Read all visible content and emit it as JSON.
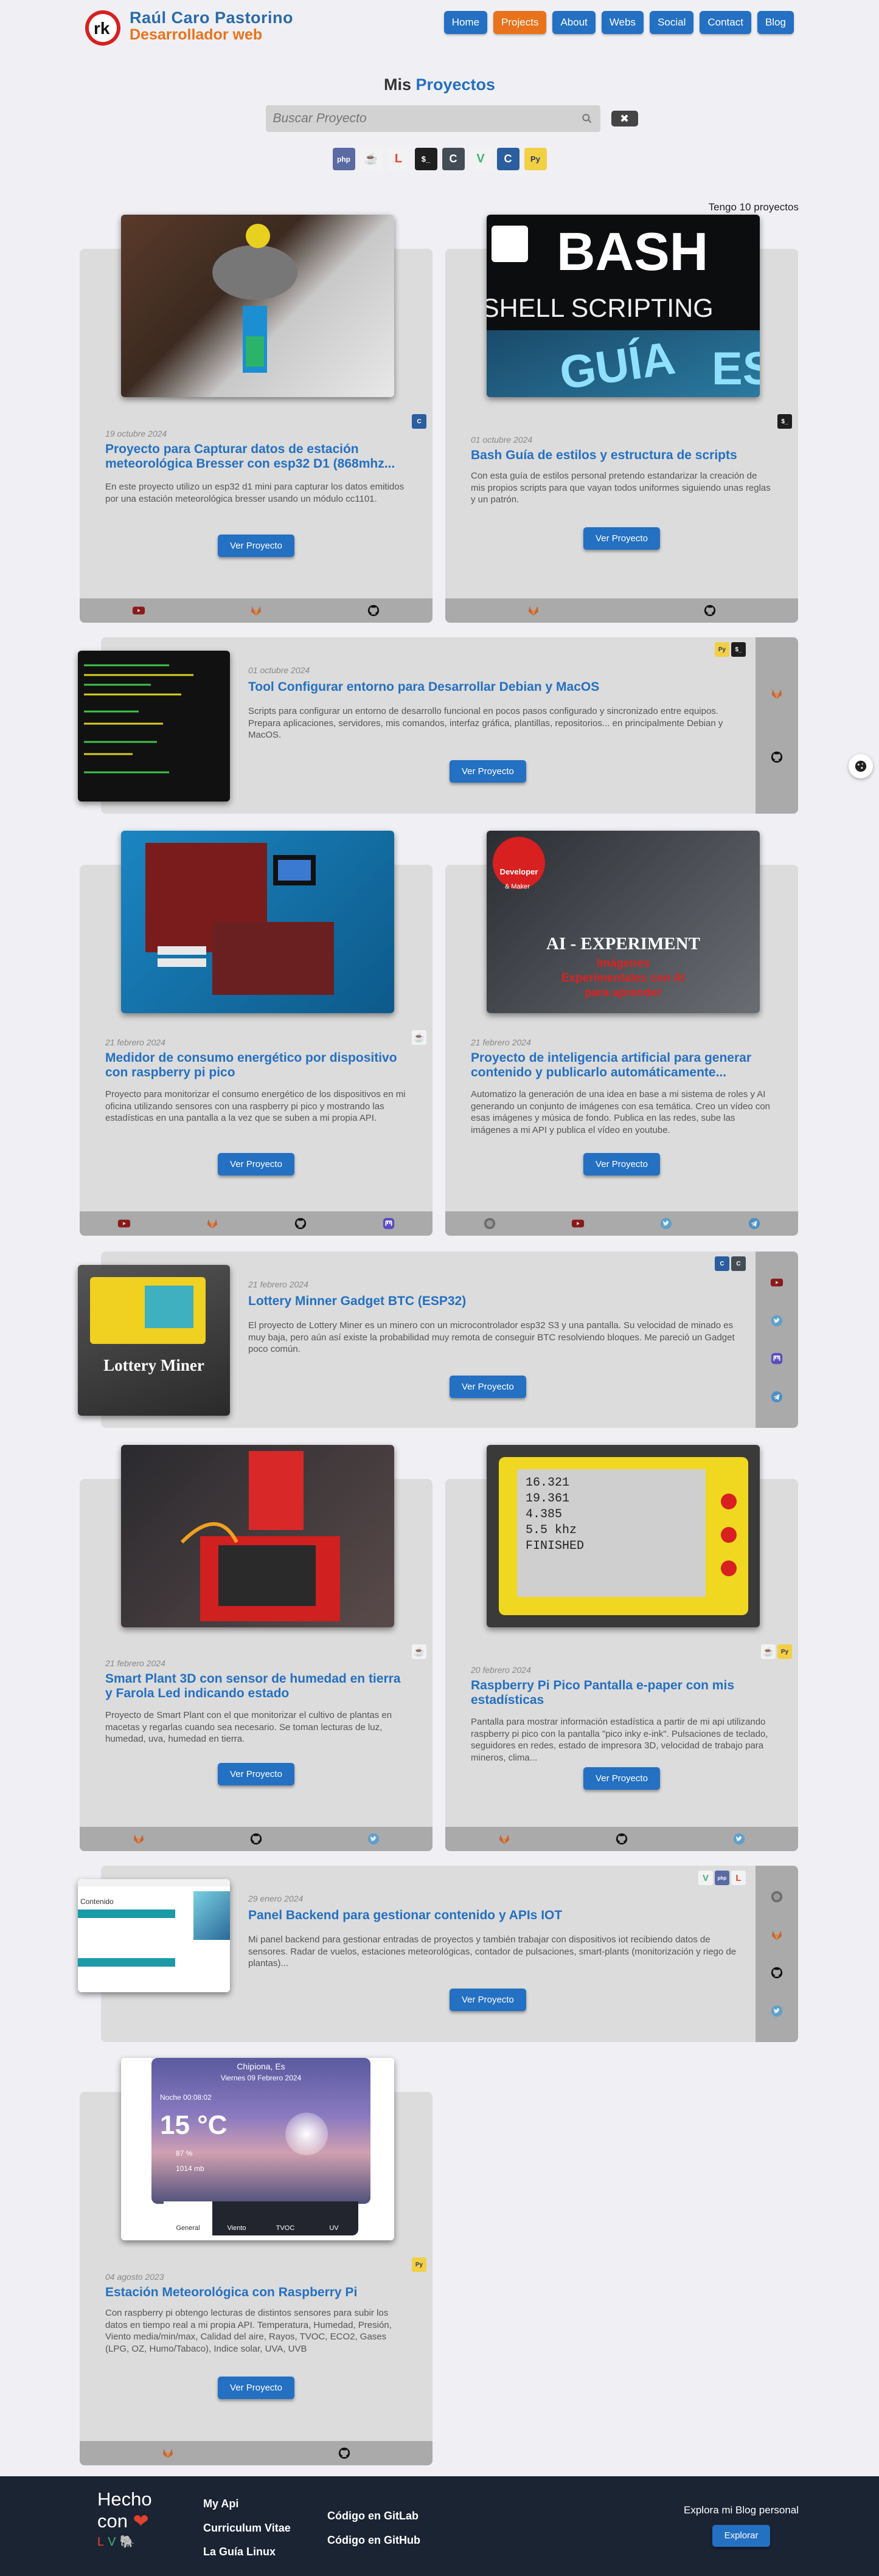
{
  "header": {
    "name": "Raúl Caro Pastorino",
    "role": "Desarrollador web",
    "nav": [
      "Home",
      "Projects",
      "About",
      "Webs",
      "Social",
      "Contact",
      "Blog"
    ],
    "active": "Projects"
  },
  "section": {
    "title_prefix": "Mis",
    "title_accent": "Proyectos"
  },
  "search": {
    "placeholder": "Buscar Proyecto",
    "clear_label": "✖"
  },
  "filters": [
    {
      "icon": "php-icon",
      "label": "php"
    },
    {
      "icon": "java-icon",
      "label": "☕"
    },
    {
      "icon": "laravel-icon",
      "label": "L"
    },
    {
      "icon": "bash-icon",
      "label": "$_"
    },
    {
      "icon": "c-icon",
      "label": "C"
    },
    {
      "icon": "vue-icon",
      "label": "V"
    },
    {
      "icon": "c-icon",
      "label": "C"
    },
    {
      "icon": "python-icon",
      "label": "Py"
    }
  ],
  "count_text": "Tengo 10 proyectos",
  "colors": {
    "primary": "#2470c2",
    "accent": "#e8731c",
    "card": "#dcdcdc",
    "bar": "#aaaaaa",
    "footer": "#1b2433"
  },
  "cta": "Ver Proyecto",
  "projects": [
    {
      "date": "19 octubre 2024",
      "title": "Proyecto para Capturar datos de estación meteorológica Bresser con esp32 D1 (868mhz...",
      "desc": "En este proyecto utilizo un esp32 d1 mini para capturar los datos emitidos por una estación meteorológica bresser usando un módulo cc1101.",
      "links": [
        "youtube-icon",
        "gitlab-icon",
        "github-icon"
      ]
    },
    {
      "date": "01 octubre 2024",
      "title": "Bash Guía de estilos y estructura de scripts",
      "desc": "Con esta guía de estilos personal pretendo estandarizar la creación de mis propios scripts para que vayan todos uniformes siguiendo unas reglas y un patrón.",
      "links": [
        "gitlab-icon",
        "github-icon"
      ],
      "img_text": [
        "BASH",
        "SHELL SCRIPTING",
        "GUÍA",
        "EST"
      ]
    },
    {
      "date": "01 octubre 2024",
      "title": "Tool Configurar entorno para Desarrollar Debian y MacOS",
      "desc": "Scripts para configurar un entorno de desarrollo funcional en pocos pasos configurado y sincronizado entre equipos. Prepara aplicaciones, servidores, mis comandos, interfaz gráfica, plantillas, repositorios... en principalmente Debian y MacOS.",
      "links": [
        "gitlab-icon",
        "github-icon"
      ]
    },
    {
      "date": "21 febrero 2024",
      "title": "Medidor de consumo energético por dispositivo con raspberry pi pico",
      "desc": "Proyecto para monitorizar el consumo energético de los dispositivos en mi oficina utilizando sensores con una raspberry pi pico y mostrando las estadísticas en una pantalla a la vez que se suben a mi propia API.",
      "links": [
        "youtube-icon",
        "gitlab-icon",
        "github-icon",
        "mastodon-icon"
      ]
    },
    {
      "date": "21 febrero 2024",
      "title": "Proyecto de inteligencia artificial para generar contenido y publicarlo automáticamente...",
      "desc": "Automatizo la generación de una idea en base a mi sistema de roles y AI generando un conjunto de imágenes con esa temática. Creo un vídeo con esas imágenes y música de fondo. Publica en las redes, sube las imágenes a mi API y publica el vídeo en youtube.",
      "links": [
        "web-icon",
        "youtube-icon",
        "twitter-icon",
        "telegram-icon"
      ],
      "img_text": [
        "Developer",
        "& Maker",
        "AI - EXPERIMENT",
        "Imágenes",
        "Experimentales con AI",
        "para aprender"
      ]
    },
    {
      "date": "21 febrero 2024",
      "title": "Lottery Minner Gadget BTC (ESP32)",
      "desc": "El proyecto de Lottery Miner es un minero con un microcontrolador esp32 S3 y una pantalla. Su velocidad de minado es muy baja, pero aún así existe la probabilidad muy remota de conseguir BTC resolviendo bloques. Me pareció un Gadget poco común.",
      "links": [
        "youtube-icon",
        "twitter-icon",
        "mastodon-icon",
        "telegram-icon"
      ],
      "img_text": [
        "Lottery Miner"
      ]
    },
    {
      "date": "21 febrero 2024",
      "title": "Smart Plant 3D con sensor de humedad en tierra y Farola Led indicando estado",
      "desc": "Proyecto de Smart Plant con el que monitorizar el cultivo de plantas en macetas y regarlas cuando sea necesario. Se toman lecturas de luz, humedad, uva, humedad en tierra.",
      "links": [
        "gitlab-icon",
        "github-icon",
        "twitter-icon"
      ]
    },
    {
      "date": "20 febrero 2024",
      "title": "Raspberry Pi Pico Pantalla e-paper con mis estadísticas",
      "desc": "Pantalla para mostrar información estadística a partir de mi api utilizando raspberry pi pico con la pantalla \"pico inky e-ink\". Pulsaciones de teclado, seguidores en redes, estado de impresora 3D, velocidad de trabajo para mineros, clima...",
      "links": [
        "gitlab-icon",
        "github-icon",
        "twitter-icon"
      ],
      "img_text": [
        "16.321",
        "19.361",
        "4.385",
        "5.5 khz",
        "FINISHED"
      ]
    },
    {
      "date": "29 enero 2024",
      "title": "Panel Backend para gestionar contenido y APIs IOT",
      "desc": "Mi panel backend para gestionar entradas de proyectos y también trabajar con dispositivos iot recibiendo datos de sensores. Radar de vuelos, estaciones meteorológicas, contador de pulsaciones, smart-plants (monitorización y riego de plantas)...",
      "links": [
        "web-icon",
        "gitlab-icon",
        "github-icon",
        "twitter-icon"
      ],
      "img_text": [
        "Contenido"
      ]
    },
    {
      "date": "04 agosto 2023",
      "title": "Estación Meteorológica con Raspberry Pi",
      "desc": "Con raspberry pi obtengo lecturas de distintos sensores para subir los datos en tiempo real a mi propia API. Temperatura, Humedad, Presión, Viento media/min/max, Calidad del aire, Rayos, TVOC, ECO2, Gases (LPG, OZ, Humo/Tabaco), Indice solar, UVA, UVB",
      "links": [
        "gitlab-icon",
        "github-icon"
      ],
      "weather": {
        "location": "Chipiona, Es",
        "date": "Viernes 09 Febrero 2024",
        "time": "Noche 00:08:02",
        "temp": "15 °C",
        "hum": "87 %",
        "pres": "1014 mb",
        "tabs": [
          "General",
          "Viento",
          "TVOC",
          "UV"
        ]
      }
    }
  ],
  "footer": {
    "made_with_line1": "Hecho",
    "made_with_line2": "con",
    "links_a": [
      "My Api",
      "Curriculum Vitae",
      "La Guía Linux"
    ],
    "links_b": [
      "Código en GitLab",
      "Código en GitHub"
    ],
    "blog_text": "Explora mi Blog personal",
    "blog_button": "Explorar"
  }
}
